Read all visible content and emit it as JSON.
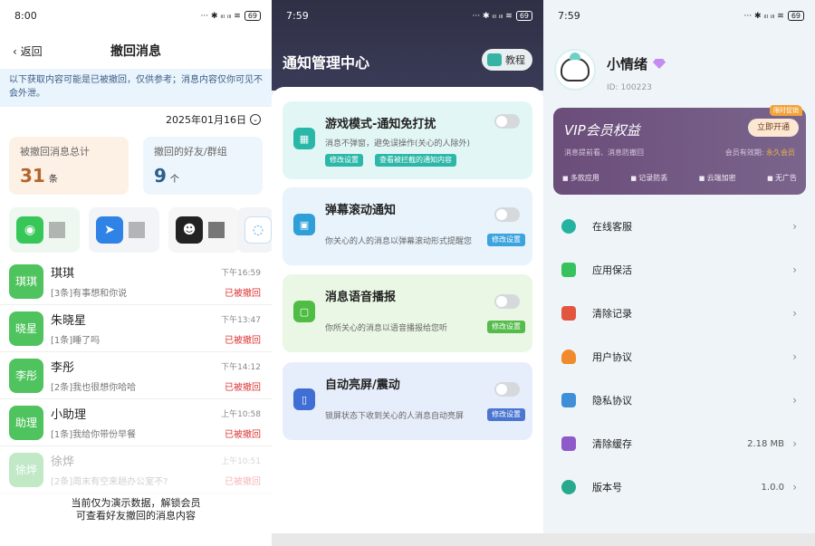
{
  "p1": {
    "status": {
      "time": "8:00",
      "icons": "··· ✱ ᵢₗₗ ᵢₗₗ ≋",
      "battery": "69"
    },
    "back": "返回",
    "title": "撤回消息",
    "notice": "以下获取内容可能是已被撤回，仅供参考；消息内容仅你可见不会外泄。",
    "date": "2025年01月16日",
    "stat1": {
      "label": "被撤回消息总计",
      "num": "31",
      "unit": "条"
    },
    "stat2": {
      "label": "撤回的好友/群组",
      "num": "9",
      "unit": "个"
    },
    "rows": [
      {
        "avatar": "琪琪",
        "name": "琪琪",
        "msg": "[3条]有事想和你说",
        "time": "下午16:59",
        "status": "已被撤回"
      },
      {
        "avatar": "晓星",
        "name": "朱晓星",
        "msg": "[1条]睡了吗",
        "time": "下午13:47",
        "status": "已被撤回"
      },
      {
        "avatar": "李彤",
        "name": "李彤",
        "msg": "[2条]我也很想你哈哈",
        "time": "下午14:12",
        "status": "已被撤回"
      },
      {
        "avatar": "助理",
        "name": "小助理",
        "msg": "[1条]我给你带份早餐",
        "time": "上午10:58",
        "status": "已被撤回"
      },
      {
        "avatar": "徐烨",
        "name": "徐烨",
        "msg": "[2条]周末有空来趟办公室不?",
        "time": "上午10:51",
        "status": "已被撤回"
      }
    ],
    "demo1": "当前仅为演示数据，解锁会员",
    "demo2": "可查看好友撤回的消息内容"
  },
  "p2": {
    "status": {
      "time": "7:59",
      "icons": "··· ✱ ᵢₗₗ ᵢₗₗ ≋",
      "battery": "69"
    },
    "title": "通知管理中心",
    "tutorial": "教程",
    "cards": [
      {
        "title": "游戏模式-通知免打扰",
        "desc": "消息不弹窗，避免误操作(关心的人除外)",
        "btn1": "修改设置",
        "btn2": "查看被拦截的通知内容",
        "icon": "▦"
      },
      {
        "title": "弹幕滚动通知",
        "desc": "你关心的人的消息以弹幕滚动形式提醒您",
        "btn1": "修改设置",
        "icon": "▣"
      },
      {
        "title": "消息语音播报",
        "desc": "你所关心的消息以语音播报给您听",
        "btn1": "修改设置",
        "icon": "▢"
      },
      {
        "title": "自动亮屏/震动",
        "desc": "锁屏状态下收到关心的人消息自动亮屏",
        "btn1": "修改设置",
        "icon": "▯"
      }
    ]
  },
  "p3": {
    "status": {
      "time": "7:59",
      "icons": "··· ✱ ᵢₗₗ ᵢₗₗ ≋",
      "battery": "69"
    },
    "name": "小情绪",
    "uid": "ID: 100223",
    "vip": {
      "title": "VIP会员权益",
      "sub": "消息提前看、消息防撤回",
      "exp_label": "会员有效期: ",
      "exp_val": "永久会员",
      "btn": "立即开通",
      "tag": "限时促销",
      "feats": [
        "多款应用",
        "记录防丢",
        "云端加密",
        "无广告"
      ]
    },
    "menu": [
      {
        "label": "在线客服",
        "value": "",
        "color": "#25b3a0"
      },
      {
        "label": "应用保活",
        "value": "",
        "color": "#36c25c"
      },
      {
        "label": "清除记录",
        "value": "",
        "color": "#e2563f"
      },
      {
        "label": "用户协议",
        "value": "",
        "color": "#f08a2c"
      },
      {
        "label": "隐私协议",
        "value": "",
        "color": "#3e8fd8"
      },
      {
        "label": "清除缓存",
        "value": "2.18 MB",
        "color": "#8e59c9"
      },
      {
        "label": "版本号",
        "value": "1.0.0",
        "color": "#27a98e"
      }
    ]
  }
}
